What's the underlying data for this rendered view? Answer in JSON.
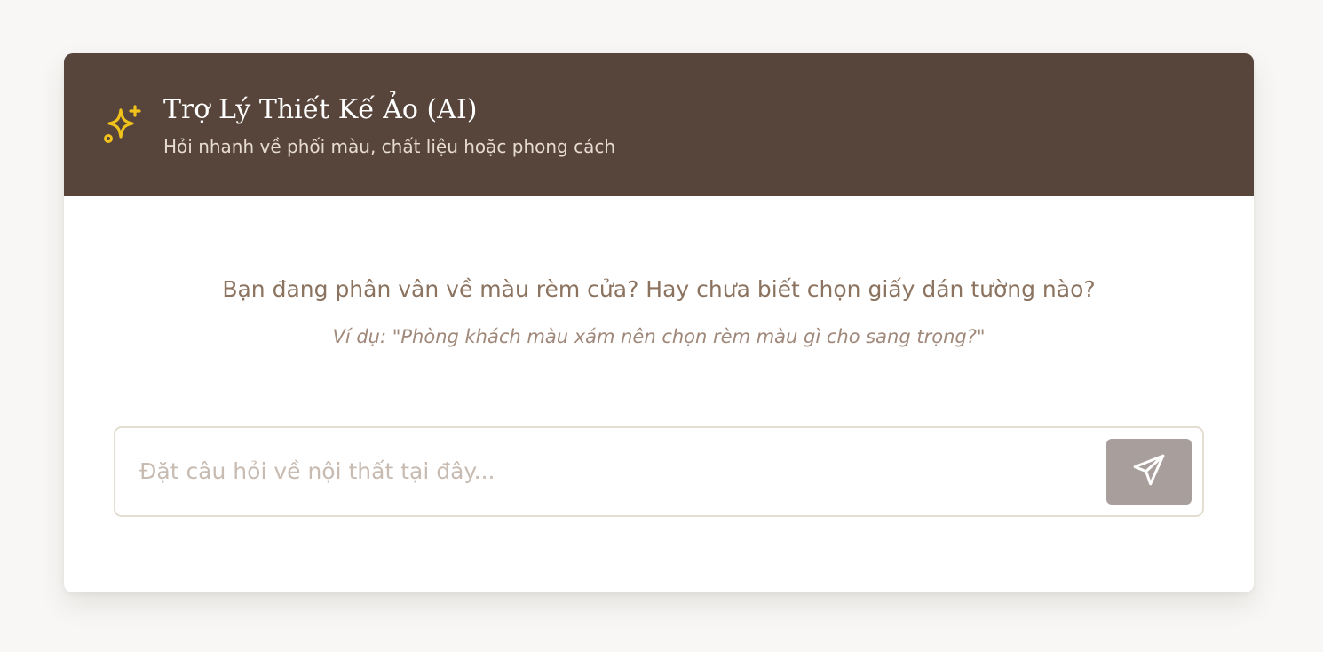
{
  "header": {
    "title": "Trợ Lý Thiết Kế Ảo (AI)",
    "subtitle": "Hỏi nhanh về phối màu, chất liệu hoặc phong cách",
    "icon": "sparkles-icon"
  },
  "main": {
    "prompt": "Bạn đang phân vân về màu rèm cửa? Hay chưa biết chọn giấy dán tường nào?",
    "example": "Ví dụ: \"Phòng khách màu xám nên chọn rèm màu gì cho sang trọng?\""
  },
  "input": {
    "value": "",
    "placeholder": "Đặt câu hỏi về nội thất tại đây...",
    "send_icon": "send-icon"
  },
  "colors": {
    "header_bg": "#57443b",
    "accent_icon": "#f1c21b",
    "send_button": "#a89e9b",
    "prompt_text": "#8b735f"
  }
}
